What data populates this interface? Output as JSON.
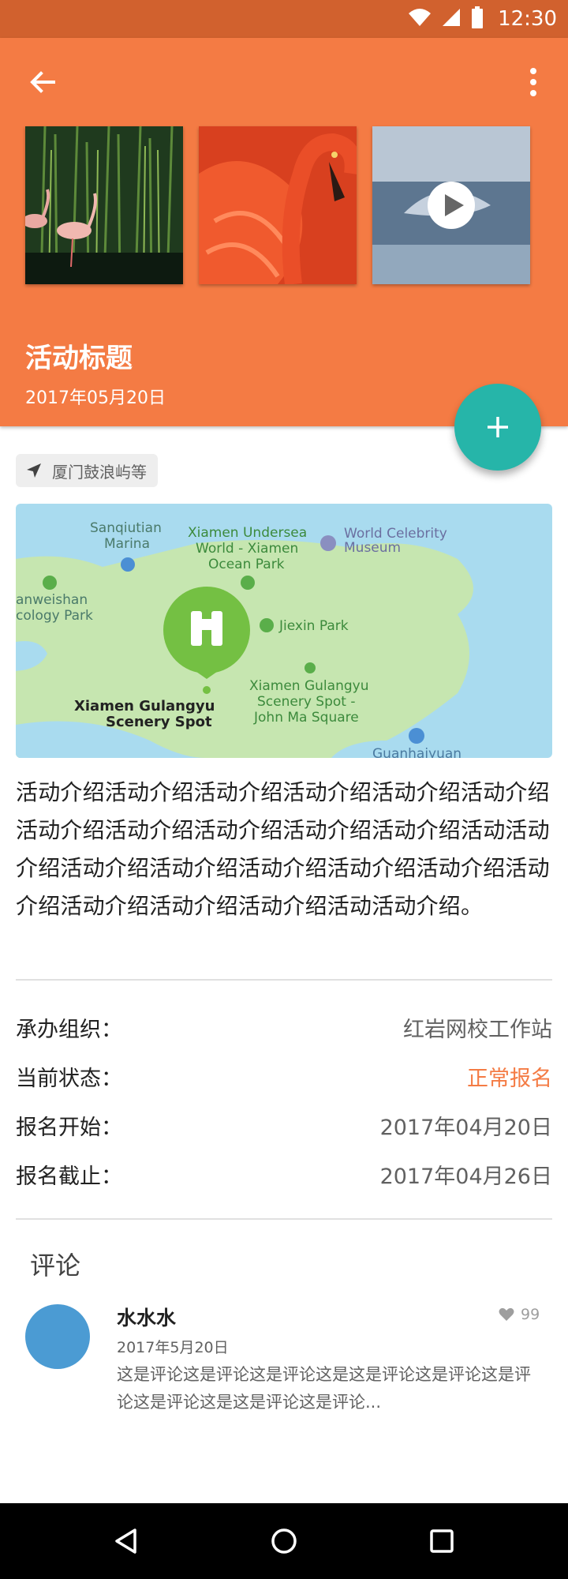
{
  "status_bar": {
    "time": "12:30"
  },
  "header": {
    "title": "活动标题",
    "date": "2017年05月20日",
    "media": [
      {
        "kind": "image",
        "label": "flamingos-in-reeds"
      },
      {
        "kind": "image",
        "label": "flamingo-closeup"
      },
      {
        "kind": "video",
        "label": "whale-video"
      }
    ]
  },
  "location": {
    "label": "厦门鼓浪屿等"
  },
  "map": {
    "labels": {
      "sanqiutian": "Sanqiutian",
      "marina": "Marina",
      "undersea1": "Xiamen Undersea",
      "undersea2": "World - Xiamen",
      "undersea3": "Ocean Park",
      "celebrity1": "World Celebrity",
      "celebrity2": "Museum",
      "yanweishan1": "anweishan",
      "yanweishan2": "cology Park",
      "jiexin": "Jiexin Park",
      "gulangyu1": "Xiamen Gulangyu",
      "gulangyu2": "Scenery Spot",
      "johnma1": "Xiamen Gulangyu",
      "johnma2": "Scenery Spot -",
      "johnma3": "John Ma Square",
      "guanhai": "Guanhaiyuan"
    }
  },
  "description": "活动介绍活动介绍活动介绍活动介绍活动介绍活动介绍活动介绍活动介绍活动介绍活动介绍活动介绍活动活动介绍活动介绍活动介绍活动介绍活动介绍活动介绍活动介绍活动介绍活动介绍活动介绍活动活动介绍。",
  "info": [
    {
      "key": "承办组织：",
      "value": "红岩网校工作站"
    },
    {
      "key": "当前状态：",
      "value": "正常报名"
    },
    {
      "key": "报名开始：",
      "value": "2017年04月20日"
    },
    {
      "key": "报名截止：",
      "value": "2017年04月26日"
    }
  ],
  "colors": {
    "primary": "#f47b44",
    "status_bar": "#d1612e",
    "fab": "#26b5a9",
    "avatar": "#4b9bd3"
  },
  "comments": {
    "title": "评论",
    "items": [
      {
        "name": "水水水",
        "date": "2017年5月20日",
        "likes": "99",
        "text": "这是评论这是评论这是评论这是这是评论这是评论这是评论这是评论这是这是评论这是评论..."
      }
    ]
  }
}
